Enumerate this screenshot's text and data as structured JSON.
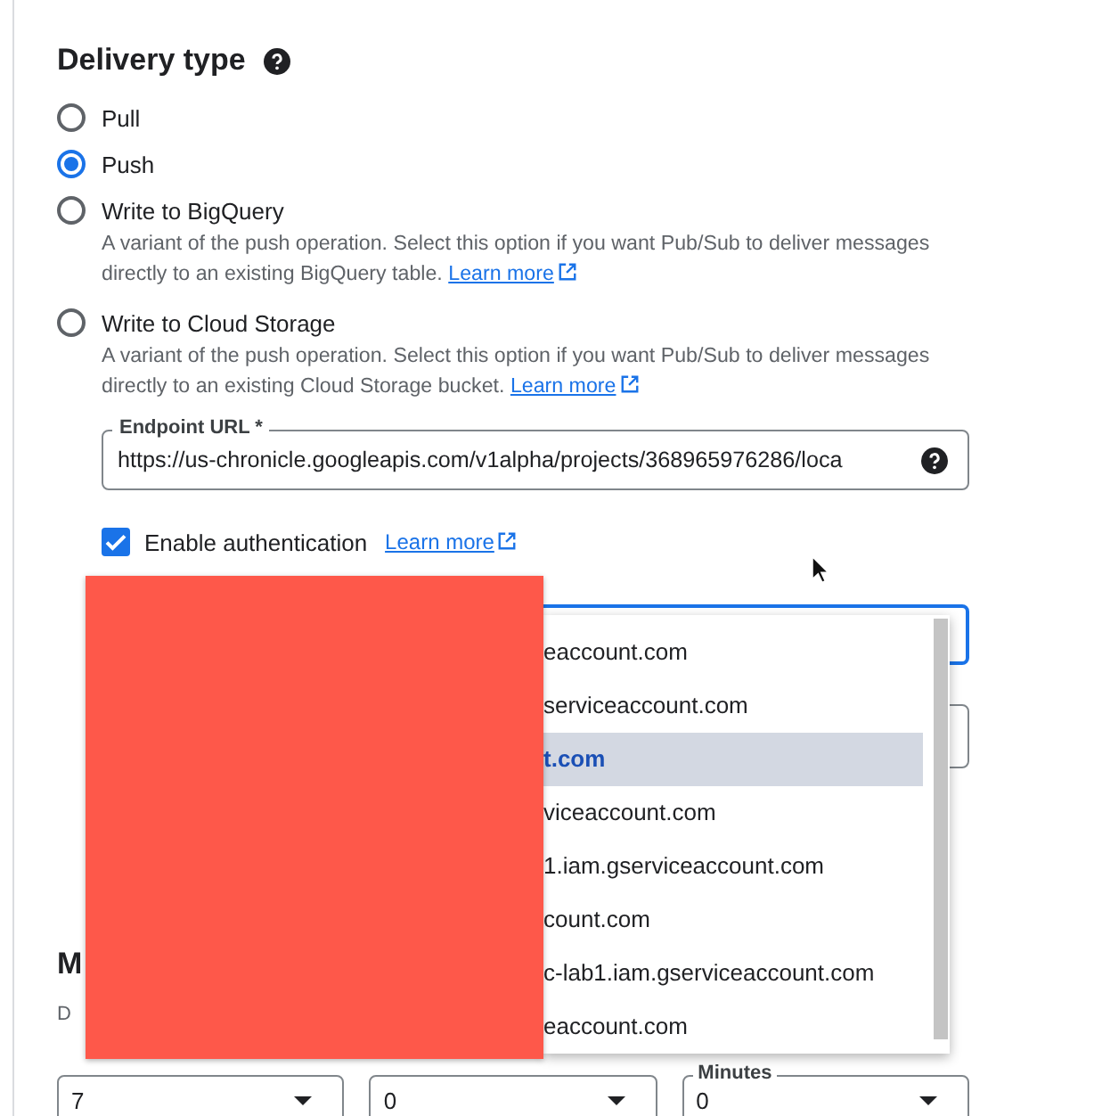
{
  "heading": {
    "title": "Delivery type"
  },
  "delivery_options": [
    {
      "label": "Pull",
      "selected": false
    },
    {
      "label": "Push",
      "selected": true
    },
    {
      "label": "Write to BigQuery",
      "selected": false,
      "description": "A variant of the push operation. Select this option if you want Pub/Sub to deliver messages directly to an existing BigQuery table.",
      "link": "Learn more"
    },
    {
      "label": "Write to Cloud Storage",
      "selected": false,
      "description": "A variant of the push operation. Select this option if you want Pub/Sub to deliver messages directly to an existing Cloud Storage bucket.",
      "link": "Learn more"
    }
  ],
  "endpoint": {
    "label": "Endpoint URL *",
    "value": "https://us-chronicle.googleapis.com/v1alpha/projects/368965976286/loca"
  },
  "authentication": {
    "label": "Enable authentication",
    "checked": true,
    "link": "Learn more"
  },
  "service_account_menu": {
    "items": [
      {
        "label": "eaccount.com",
        "selected": false
      },
      {
        "label": "serviceaccount.com",
        "selected": false
      },
      {
        "label": "t.com",
        "selected": true
      },
      {
        "label": "viceaccount.com",
        "selected": false
      },
      {
        "label": "1.iam.gserviceaccount.com",
        "selected": false
      },
      {
        "label": "count.com",
        "selected": false
      },
      {
        "label": "c-lab1.iam.gserviceaccount.com",
        "selected": false
      },
      {
        "label": "eaccount.com",
        "selected": false
      }
    ]
  },
  "section_heading": "M",
  "field_label": "D",
  "duration_selects": [
    {
      "value": "7"
    },
    {
      "value": "0"
    },
    {
      "label": "Minutes",
      "value": "0"
    }
  ]
}
